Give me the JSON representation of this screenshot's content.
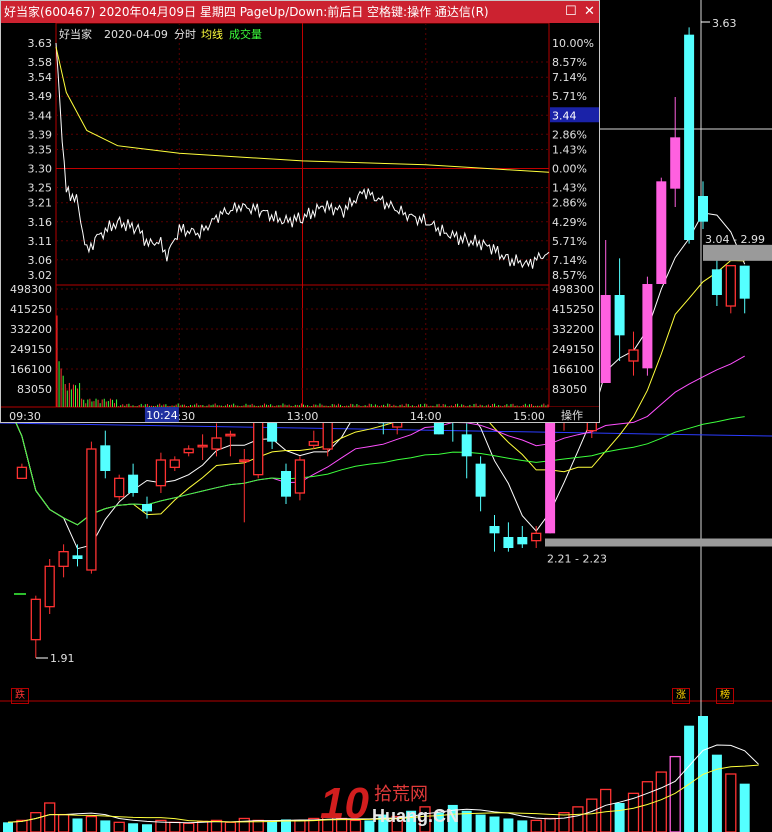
{
  "window": {
    "title": "好当家(600467)  2020年04月09日  星期四  PageUp/Down:前后日  空格键:操作  通达信(R)",
    "restore_glyph": "☐",
    "close_glyph": "✕"
  },
  "intraday": {
    "stock_name": "好当家",
    "date": "2020-04-09",
    "mode": "分时",
    "avg_label": "均线",
    "vol_label": "成交量",
    "current_price": "3.44",
    "action_label": "操作",
    "cursor_time": "10:24",
    "prev_close": 3.3,
    "price_ticks_left": [
      "3.63",
      "3.58",
      "3.54",
      "3.49",
      "3.44",
      "3.39",
      "3.35",
      "3.30",
      "3.25",
      "3.21",
      "3.16",
      "3.11",
      "3.06",
      "3.02"
    ],
    "price_ticks_right": [
      "10.00%",
      "8.57%",
      "7.14%",
      "5.71%",
      "4.29%",
      "2.86%",
      "1.43%",
      "0.00%",
      "1.43%",
      "2.86%",
      "4.29%",
      "5.71%",
      "7.14%",
      "8.57%"
    ],
    "volume_ticks": [
      "498300",
      "415250",
      "332200",
      "249150",
      "166100",
      "83050"
    ],
    "time_labels": [
      "09:30",
      "10:30",
      "13:00",
      "14:00",
      "15:00"
    ]
  },
  "chart_data": [
    {
      "type": "line",
      "title": "好当家  2020-04-09  分时",
      "series": [
        {
          "name": "价格",
          "x": [
            "09:30",
            "09:31",
            "09:33",
            "09:35",
            "09:40",
            "09:45",
            "09:50",
            "10:00",
            "10:10",
            "10:15",
            "10:20",
            "10:24",
            "10:30",
            "10:40",
            "10:50",
            "11:00",
            "11:10",
            "11:20",
            "11:30",
            "13:00",
            "13:10",
            "13:20",
            "13:30",
            "13:40",
            "13:50",
            "14:00",
            "14:10",
            "14:20",
            "14:30",
            "14:40",
            "14:50",
            "15:00"
          ],
          "values": [
            3.63,
            3.55,
            3.38,
            3.24,
            3.22,
            3.08,
            3.12,
            3.16,
            3.14,
            3.1,
            3.11,
            3.07,
            3.14,
            3.13,
            3.18,
            3.2,
            3.19,
            3.16,
            3.17,
            3.17,
            3.2,
            3.19,
            3.24,
            3.21,
            3.18,
            3.16,
            3.13,
            3.11,
            3.1,
            3.06,
            3.05,
            3.08
          ]
        },
        {
          "name": "均线",
          "x": [
            "09:30",
            "09:35",
            "09:45",
            "10:00",
            "10:30",
            "11:00",
            "11:30",
            "13:00",
            "14:00",
            "14:30",
            "15:00"
          ],
          "values": [
            3.62,
            3.5,
            3.4,
            3.36,
            3.34,
            3.33,
            3.32,
            3.32,
            3.31,
            3.3,
            3.29
          ]
        }
      ],
      "volume_total_bars": 240,
      "ylim": [
        3.02,
        3.63
      ],
      "volume_max": 498300,
      "grid": true
    },
    {
      "type": "candlestick",
      "title": "",
      "annotations": [
        "1.91",
        "2.21 - 2.23",
        "3.04 - 2.99",
        "3.63"
      ],
      "candles": [
        {
          "o": 2.65,
          "h": 2.68,
          "l": 2.58,
          "c": 2.6
        },
        {
          "o": 2.4,
          "h": 2.44,
          "l": 2.4,
          "c": 2.43
        },
        {
          "o": 1.96,
          "h": 2.08,
          "l": 1.91,
          "c": 2.07
        },
        {
          "o": 2.05,
          "h": 2.18,
          "l": 2.03,
          "c": 2.16
        },
        {
          "o": 2.16,
          "h": 2.22,
          "l": 2.13,
          "c": 2.2
        },
        {
          "o": 2.19,
          "h": 2.22,
          "l": 2.16,
          "c": 2.18
        },
        {
          "o": 2.15,
          "h": 2.5,
          "l": 2.14,
          "c": 2.48
        },
        {
          "o": 2.49,
          "h": 2.53,
          "l": 2.4,
          "c": 2.42
        },
        {
          "o": 2.35,
          "h": 2.41,
          "l": 2.34,
          "c": 2.4
        },
        {
          "o": 2.41,
          "h": 2.44,
          "l": 2.35,
          "c": 2.36
        },
        {
          "o": 2.33,
          "h": 2.35,
          "l": 2.29,
          "c": 2.31
        },
        {
          "o": 2.38,
          "h": 2.47,
          "l": 2.36,
          "c": 2.45
        },
        {
          "o": 2.43,
          "h": 2.46,
          "l": 2.42,
          "c": 2.45
        },
        {
          "o": 2.47,
          "h": 2.49,
          "l": 2.46,
          "c": 2.48
        },
        {
          "o": 2.49,
          "h": 2.52,
          "l": 2.45,
          "c": 2.49
        },
        {
          "o": 2.48,
          "h": 2.55,
          "l": 2.46,
          "c": 2.51
        },
        {
          "o": 2.52,
          "h": 2.53,
          "l": 2.46,
          "c": 2.52
        },
        {
          "o": 2.45,
          "h": 2.48,
          "l": 2.28,
          "c": 2.45
        },
        {
          "o": 2.41,
          "h": 2.58,
          "l": 2.4,
          "c": 2.56
        },
        {
          "o": 2.56,
          "h": 2.58,
          "l": 2.48,
          "c": 2.5
        },
        {
          "o": 2.42,
          "h": 2.44,
          "l": 2.33,
          "c": 2.35
        },
        {
          "o": 2.36,
          "h": 2.46,
          "l": 2.34,
          "c": 2.45
        },
        {
          "o": 2.49,
          "h": 2.53,
          "l": 2.48,
          "c": 2.5
        },
        {
          "o": 2.48,
          "h": 2.58,
          "l": 2.46,
          "c": 2.56
        },
        {
          "o": 2.6,
          "h": 2.73,
          "l": 2.59,
          "c": 2.7
        },
        {
          "o": 2.61,
          "h": 2.71,
          "l": 2.58,
          "c": 2.67
        },
        {
          "o": 2.64,
          "h": 2.7,
          "l": 2.6,
          "c": 2.6
        },
        {
          "o": 2.62,
          "h": 2.65,
          "l": 2.52,
          "c": 2.55
        },
        {
          "o": 2.54,
          "h": 2.68,
          "l": 2.52,
          "c": 2.67
        },
        {
          "o": 2.73,
          "h": 2.83,
          "l": 2.58,
          "c": 2.61
        },
        {
          "o": 2.59,
          "h": 2.72,
          "l": 2.59,
          "c": 2.7
        },
        {
          "o": 2.67,
          "h": 2.72,
          "l": 2.52,
          "c": 2.52
        },
        {
          "o": 2.67,
          "h": 2.7,
          "l": 2.5,
          "c": 2.66
        },
        {
          "o": 2.52,
          "h": 2.55,
          "l": 2.4,
          "c": 2.46
        },
        {
          "o": 2.44,
          "h": 2.46,
          "l": 2.31,
          "c": 2.35
        },
        {
          "o": 2.27,
          "h": 2.3,
          "l": 2.2,
          "c": 2.25
        },
        {
          "o": 2.24,
          "h": 2.28,
          "l": 2.2,
          "c": 2.21
        },
        {
          "o": 2.24,
          "h": 2.27,
          "l": 2.21,
          "c": 2.22
        },
        {
          "o": 2.23,
          "h": 2.27,
          "l": 2.21,
          "c": 2.25
        },
        {
          "o": 2.25,
          "h": 2.62,
          "l": 2.25,
          "c": 2.61
        },
        {
          "o": 2.58,
          "h": 2.72,
          "l": 2.53,
          "c": 2.65
        },
        {
          "o": 2.6,
          "h": 2.66,
          "l": 2.57,
          "c": 2.64
        },
        {
          "o": 2.53,
          "h": 2.67,
          "l": 2.51,
          "c": 2.66
        },
        {
          "o": 2.66,
          "h": 3.05,
          "l": 2.66,
          "c": 2.9
        },
        {
          "o": 2.9,
          "h": 3.0,
          "l": 2.72,
          "c": 2.79
        },
        {
          "o": 2.72,
          "h": 2.8,
          "l": 2.68,
          "c": 2.75
        },
        {
          "o": 2.7,
          "h": 2.95,
          "l": 2.68,
          "c": 2.93
        },
        {
          "o": 2.93,
          "h": 3.22,
          "l": 2.93,
          "c": 3.21
        },
        {
          "o": 3.19,
          "h": 3.44,
          "l": 3.14,
          "c": 3.33
        },
        {
          "o": 3.61,
          "h": 3.63,
          "l": 3.04,
          "c": 3.05
        },
        {
          "o": 3.17,
          "h": 3.21,
          "l": 3.08,
          "c": 3.1
        },
        {
          "o": 2.97,
          "h": 3.0,
          "l": 2.87,
          "c": 2.9
        },
        {
          "o": 2.87,
          "h": 2.98,
          "l": 2.85,
          "c": 2.98
        },
        {
          "o": 2.98,
          "h": 2.98,
          "l": 2.85,
          "c": 2.89
        }
      ],
      "ylim": [
        1.85,
        3.65
      ]
    }
  ],
  "badges": {
    "die": "跌",
    "zhang": "涨",
    "bang": "榜"
  },
  "watermark": {
    "number": "10",
    "cn": "拾荒网",
    "en": "Huang.CN"
  },
  "colors": {
    "up": "#ff3232",
    "down": "#54ffff",
    "limit_up": "#ff60e0",
    "frame": "#b40000",
    "title_bar": "#cc2230"
  }
}
